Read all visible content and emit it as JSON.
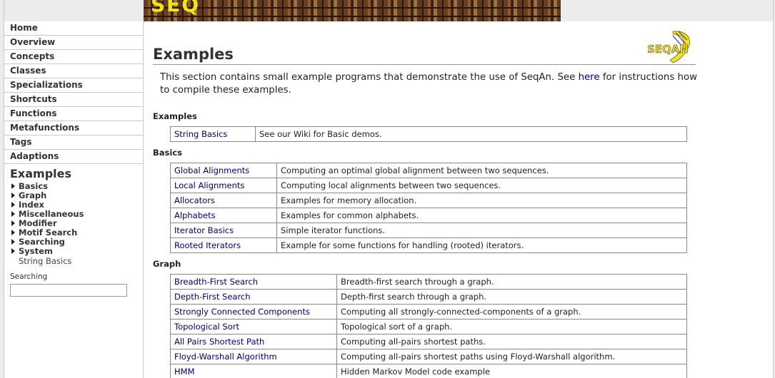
{
  "sidebar": {
    "nav": [
      "Home",
      "Overview",
      "Concepts",
      "Classes",
      "Specializations",
      "Shortcuts",
      "Functions",
      "Metafunctions",
      "Tags",
      "Adaptions"
    ],
    "active": "Examples",
    "subs": [
      "Basics",
      "Graph",
      "Index",
      "Miscellaneous",
      "Modifier",
      "Motif Search",
      "Searching",
      "System"
    ],
    "sub_plain": "String Basics",
    "search_label": "Searching",
    "search_value": ""
  },
  "banner": {
    "logo_text": "SEQ"
  },
  "logo_right": {
    "text": "SEQAN"
  },
  "main": {
    "title": "Examples",
    "intro_pre": "This section contains small example programs that demonstrate the use of SeqAn. See",
    "intro_link": "here",
    "intro_post": "for instructions how to compile these examples."
  },
  "sections": [
    {
      "heading": "Examples",
      "rows": [
        {
          "name": "String Basics",
          "desc": "See our Wiki for Basic demos."
        }
      ]
    },
    {
      "heading": "Basics",
      "rows": [
        {
          "name": "Global Alignments",
          "desc": "Computing an optimal global alignment between two sequences."
        },
        {
          "name": "Local Alignments",
          "desc": "Computing local alignments between two sequences."
        },
        {
          "name": "Allocators",
          "desc": "Examples for memory allocation."
        },
        {
          "name": "Alphabets",
          "desc": "Examples for common alphabets."
        },
        {
          "name": "Iterator Basics",
          "desc": "Simple iterator functions."
        },
        {
          "name": "Rooted Iterators",
          "desc": "Example for some functions for handling (rooted) iterators."
        }
      ]
    },
    {
      "heading": "Graph",
      "rows": [
        {
          "name": "Breadth-First Search",
          "desc": "Breadth-first search through a graph."
        },
        {
          "name": "Depth-First Search",
          "desc": "Depth-first search through a graph."
        },
        {
          "name": "Strongly Connected Components",
          "desc": "Computing all strongly-connected-components of a graph."
        },
        {
          "name": "Topological Sort",
          "desc": "Topological sort of a graph."
        },
        {
          "name": "All Pairs Shortest Path",
          "desc": "Computing all-pairs shortest paths."
        },
        {
          "name": "Floyd-Warshall Algorithm",
          "desc": "Computing all-pairs shortest paths using Floyd-Warshall algorithm."
        },
        {
          "name": "HMM",
          "desc": "Hidden Markov Model code example"
        }
      ]
    }
  ],
  "colors": {
    "link": "#00006e",
    "logo_yellow": "#f2e21a"
  }
}
